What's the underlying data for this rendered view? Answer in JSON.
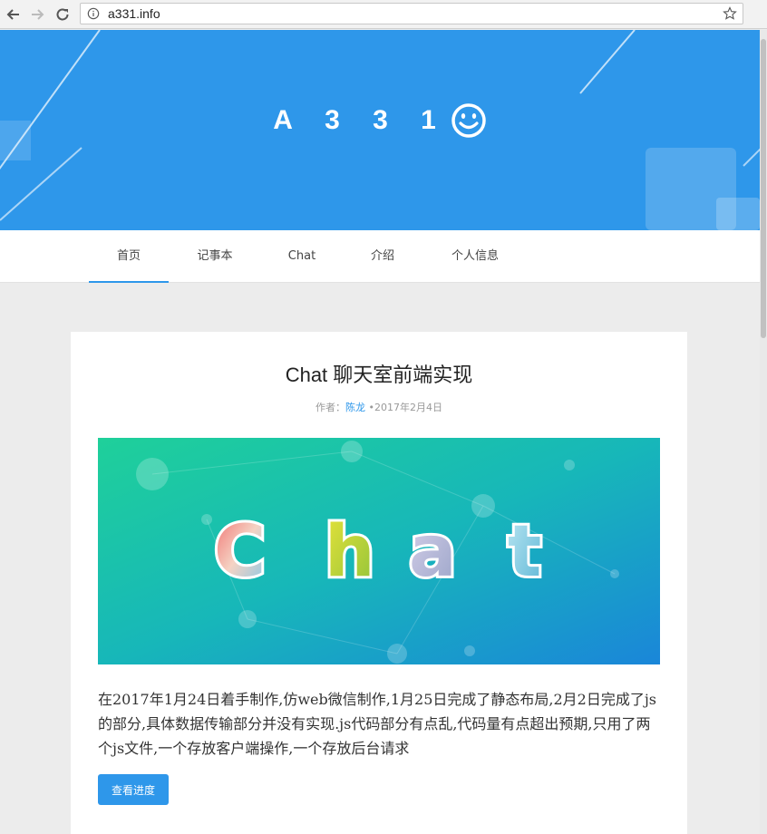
{
  "browser": {
    "url": "a331.info",
    "icons": {
      "back": "arrow-left-icon",
      "forward": "arrow-right-icon",
      "reload": "reload-icon",
      "info": "info-icon",
      "bookmark": "star-icon"
    }
  },
  "site": {
    "title": "A 3 3 1",
    "brand_color": "#2e97ea"
  },
  "nav": {
    "items": [
      {
        "label": "首页",
        "active": true
      },
      {
        "label": "记事本"
      },
      {
        "label": "Chat"
      },
      {
        "label": "介绍"
      },
      {
        "label": "个人信息"
      }
    ]
  },
  "post": {
    "title": "Chat 聊天室前端实现",
    "meta_prefix": "作者：",
    "author": "陈龙",
    "date": " •2017年2月4日",
    "image_text": "Chat",
    "excerpt": "在2017年1月24日着手制作,仿web微信制作,1月25日完成了静态布局,2月2日完成了js的部分,具体数据传输部分并没有实现.js代码部分有点乱,代码量有点超出预期,只用了两个js文件,一个存放客户端操作,一个存放后台请求",
    "button_label": "查看进度"
  }
}
